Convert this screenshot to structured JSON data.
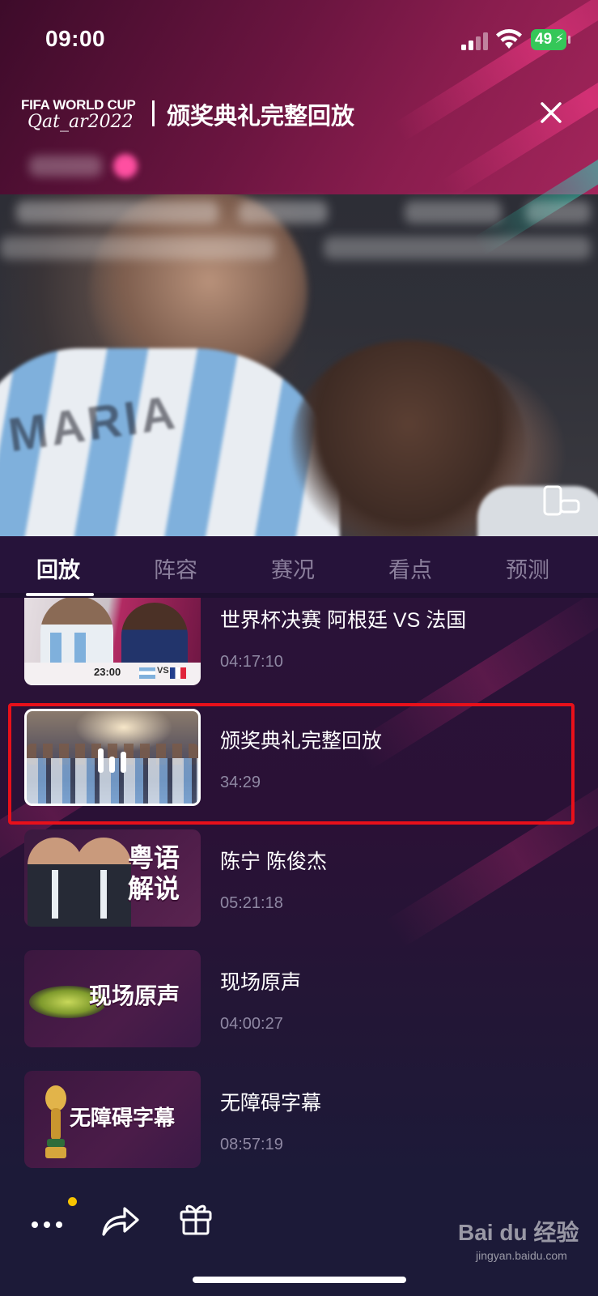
{
  "status_bar": {
    "time": "09:00",
    "battery": "49"
  },
  "header": {
    "logo_line1": "FIFA WORLD CUP",
    "logo_line2": "Qat_ar2022",
    "title": "颁奖典礼完整回放"
  },
  "tabs": [
    {
      "label": "回放",
      "active": true
    },
    {
      "label": "阵容",
      "active": false
    },
    {
      "label": "赛况",
      "active": false
    },
    {
      "label": "看点",
      "active": false
    },
    {
      "label": "预测",
      "active": false
    }
  ],
  "list": [
    {
      "title": "世界杯决赛 阿根廷 VS 法国",
      "duration": "04:17:10",
      "thumb_time": "23:00",
      "thumb_vs": "VS"
    },
    {
      "title": "颁奖典礼完整回放",
      "duration": "34:29",
      "playing": true
    },
    {
      "title": "陈宁 陈俊杰",
      "duration": "05:21:18",
      "thumb_label_1": "粤语",
      "thumb_label_2": "解说"
    },
    {
      "title": "现场原声",
      "duration": "04:00:27",
      "thumb_label": "现场原声"
    },
    {
      "title": "无障碍字幕",
      "duration": "08:57:19",
      "thumb_label": "无障碍字幕"
    }
  ],
  "watermark": {
    "brand": "Bai du 经验",
    "url": "jingyan.baidu.com"
  },
  "colors": {
    "highlight_border": "#e8101a",
    "battery_green": "#35c759",
    "notification_dot": "#f7c400",
    "background": "#1e1030"
  },
  "icons": [
    "signal-icon",
    "wifi-icon",
    "close-icon",
    "rotate-screen-icon",
    "more-icon",
    "share-icon",
    "gift-icon"
  ]
}
